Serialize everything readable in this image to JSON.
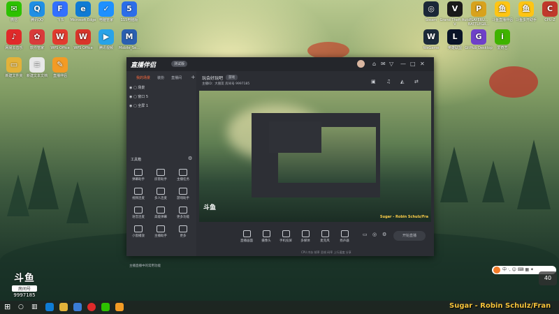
{
  "desktop_icons_left": [
    {
      "label": "微信",
      "icon": "wechat-icon",
      "color": "#2dc100",
      "glyph": "✉"
    },
    {
      "label": "腾讯QQ",
      "icon": "qq-icon",
      "color": "#1f8fe5",
      "glyph": "Q"
    },
    {
      "label": "飞书",
      "icon": "feishu-icon",
      "color": "#3370ff",
      "glyph": "F"
    },
    {
      "label": "Microsoft Edge",
      "icon": "edge-icon",
      "color": "#0f7bd4",
      "glyph": "e"
    },
    {
      "label": "电脑管家",
      "icon": "pc-manager-icon",
      "color": "#1e90ff",
      "glyph": "✓"
    },
    {
      "label": "115电脑版",
      "icon": "115-icon",
      "color": "#2b6de8",
      "glyph": "5"
    },
    {
      "label": "网易云音乐",
      "icon": "netease-music-icon",
      "color": "#e02a2a",
      "glyph": "♪"
    },
    {
      "label": "软件管家",
      "icon": "software-manager-icon",
      "color": "#d93b3b",
      "glyph": "✿"
    },
    {
      "label": "WPS Office",
      "icon": "wps-icon",
      "color": "#e23b2e",
      "glyph": "W"
    },
    {
      "label": "WPS Office",
      "icon": "wps-icon-2",
      "color": "#d8352a",
      "glyph": "W"
    },
    {
      "label": "腾讯视频",
      "icon": "tencent-video-icon",
      "color": "#29a3e8",
      "glyph": "▶"
    },
    {
      "label": "Mobile_Se...",
      "icon": "mobile-icon",
      "color": "#2a5fb0",
      "glyph": "M"
    },
    {
      "label": "新建文件夹",
      "icon": "folder-icon",
      "color": "#e3b23a",
      "glyph": "▭"
    },
    {
      "label": "新建文本文档",
      "icon": "text-doc-icon",
      "color": "#e8e8e8",
      "glyph": "≡"
    },
    {
      "label": "直播伴侣",
      "icon": "live-companion-icon",
      "color": "#f39b25",
      "glyph": "✎"
    }
  ],
  "desktop_icons_right": [
    {
      "label": "Steam",
      "icon": "steam-icon",
      "color": "#1b2838",
      "glyph": "◎"
    },
    {
      "label": "Grand Theft Auto V",
      "icon": "gta-icon",
      "color": "#1a1a1a",
      "glyph": "V"
    },
    {
      "label": "PLAYERU... BATTLEGR...",
      "icon": "pubg-icon",
      "color": "#d8a21c",
      "glyph": "P"
    },
    {
      "label": "斗鱼直播伴侣",
      "icon": "douyu-icon",
      "color": "#ffc514",
      "glyph": "鱼"
    },
    {
      "label": "斗鱼多开助手",
      "icon": "douyu-multi-icon",
      "color": "#ffc514",
      "glyph": "鱼"
    },
    {
      "label": "CPU-Z",
      "icon": "cpuz-icon",
      "color": "#c0392b",
      "glyph": "C"
    },
    {
      "label": "WeGame",
      "icon": "wegame-icon",
      "color": "#1d2b3a",
      "glyph": "W"
    },
    {
      "label": "英雄联盟",
      "icon": "lol-icon",
      "color": "#0a1428",
      "glyph": "L"
    },
    {
      "label": "GitHub Desktop",
      "icon": "github-icon",
      "color": "#6e40c9",
      "glyph": "G"
    },
    {
      "label": "爱奇艺",
      "icon": "iqiyi-icon",
      "color": "#3fb300",
      "glyph": "i"
    }
  ],
  "app": {
    "logo": "直播伴侣",
    "beta": "测试版",
    "sidebar_tabs": [
      "我的场景",
      "装扮",
      "直播间"
    ],
    "scenes": [
      "场景",
      "窗口 5",
      "全屏 1"
    ],
    "toolbox_title": "工具箱",
    "tools": [
      "弹幕助手",
      "房管助手",
      "主播任务",
      "视频连麦",
      "多人连麦",
      "游戏助手",
      "语音连麦",
      "高能弹幕",
      "更多功能",
      "小窗播放",
      "主播助手",
      "更多"
    ],
    "notice": "主播直播中的常用功能",
    "room_title": "玩会好玩吧",
    "room_tag": "游戏",
    "room_info": "主播ID：大朋友  房间号 9997185",
    "preview_song": "Sugar - Robin Schulz/Fra",
    "bottom_tools": [
      "直播画面",
      "摄像头",
      "手机投屏",
      "多媒体",
      "麦克风",
      "扬声器"
    ],
    "go_live": "开始直播",
    "status_line": "CPU  内存  帧率  丢帧  码率  上行速度  分享"
  },
  "douyu_badge": {
    "logo": "斗鱼",
    "label": "房间号",
    "room": "9997185"
  },
  "taskbar": {
    "song": "Sugar - Robin Schulz/Fran",
    "clock": "40"
  },
  "ime": "中 ·, ☺ ⌨ ▦ ✦"
}
